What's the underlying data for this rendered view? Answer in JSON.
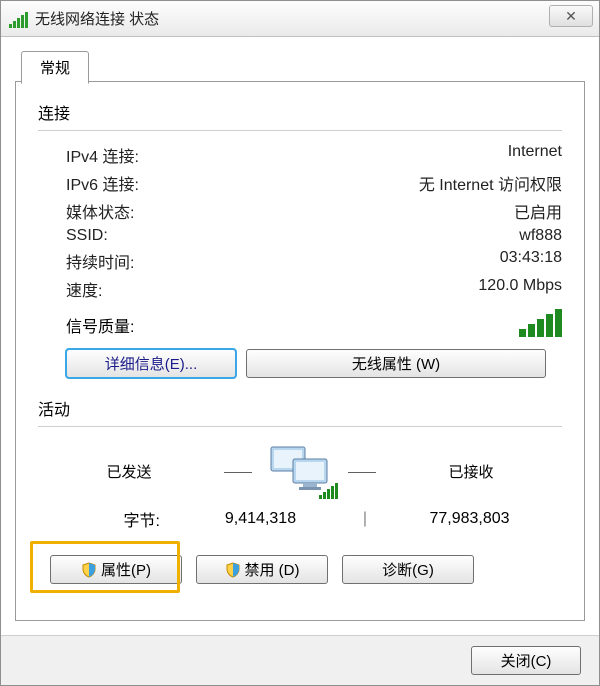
{
  "window": {
    "title": "无线网络连接 状态",
    "close_glyph": "✕"
  },
  "tabs": {
    "general": "常规"
  },
  "connection": {
    "section": "连接",
    "ipv4_label": "IPv4 连接:",
    "ipv4_value": "Internet",
    "ipv6_label": "IPv6 连接:",
    "ipv6_value": "无 Internet 访问权限",
    "media_label": "媒体状态:",
    "media_value": "已启用",
    "ssid_label": "SSID:",
    "ssid_value": "wf888",
    "duration_label": "持续时间:",
    "duration_value": "03:43:18",
    "speed_label": "速度:",
    "speed_value": "120.0 Mbps",
    "signal_label": "信号质量:"
  },
  "buttons": {
    "details": "详细信息(E)...",
    "wireless_props": "无线属性 (W)",
    "properties": "属性(P)",
    "disable": "禁用 (D)",
    "diagnose": "诊断(G)",
    "close": "关闭(C)"
  },
  "activity": {
    "section": "活动",
    "sent_label": "已发送",
    "recv_label": "已接收",
    "bytes_label": "字节:",
    "sent_bytes": "9,414,318",
    "recv_bytes": "77,983,803"
  }
}
